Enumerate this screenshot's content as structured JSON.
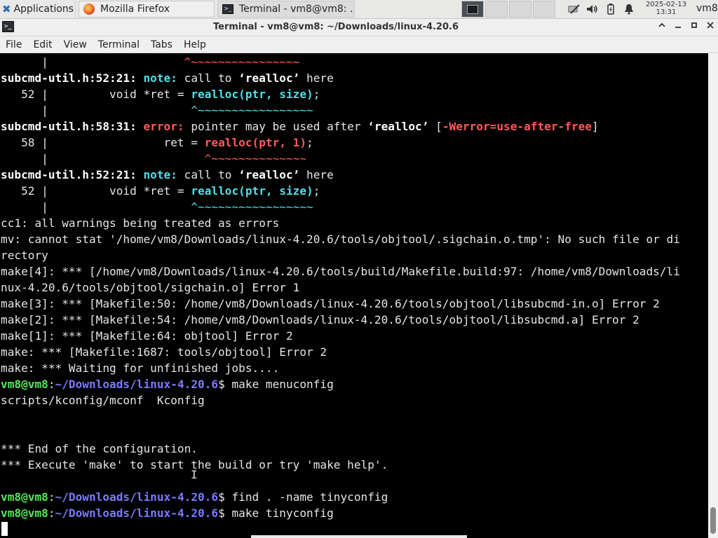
{
  "taskbar": {
    "apps_menu_label": "Applications",
    "tasks": [
      {
        "label": "Mozilla Firefox",
        "icon": "firefox-icon"
      },
      {
        "label": "Terminal - vm8@vm8: ...",
        "icon": "terminal-icon"
      }
    ],
    "workspaces": 4,
    "clock_date": "2025-02-13",
    "clock_time": "13:31",
    "user": "vm8",
    "tray_icons": [
      "network-icon",
      "volume-icon",
      "battery-icon",
      "notification-bell-icon"
    ]
  },
  "window": {
    "title": "Terminal - vm8@vm8: ~/Downloads/linux-4.20.6"
  },
  "menubar": {
    "items": [
      "File",
      "Edit",
      "View",
      "Terminal",
      "Tabs",
      "Help"
    ]
  },
  "terminal": {
    "lines": [
      [
        {
          "t": "      |                    "
        },
        {
          "t": "^~~~~~~~~~~~~~~~~",
          "c": "r"
        }
      ],
      [
        {
          "t": "subcmd-util.h:52:21: ",
          "c": "w b"
        },
        {
          "t": "note: ",
          "c": "c b"
        },
        {
          "t": "call to "
        },
        {
          "t": "‘realloc’",
          "c": "w b"
        },
        {
          "t": " here"
        }
      ],
      [
        {
          "t": "   52 |         void *ret = "
        },
        {
          "t": "realloc(ptr, size)",
          "c": "c b"
        },
        {
          "t": ";"
        }
      ],
      [
        {
          "t": "      |                     "
        },
        {
          "t": "^~~~~~~~~~~~~~~~~~",
          "c": "c"
        }
      ],
      [
        {
          "t": "subcmd-util.h:58:31: ",
          "c": "w b"
        },
        {
          "t": "error: ",
          "c": "r b"
        },
        {
          "t": "pointer may be used after "
        },
        {
          "t": "‘realloc’",
          "c": "w b"
        },
        {
          "t": " ["
        },
        {
          "t": "-Werror=use-after-free",
          "c": "r b"
        },
        {
          "t": "]"
        }
      ],
      [
        {
          "t": "   58 |                 ret = "
        },
        {
          "t": "realloc(ptr, 1)",
          "c": "r b"
        },
        {
          "t": ";"
        }
      ],
      [
        {
          "t": "      |                       "
        },
        {
          "t": "^~~~~~~~~~~~~~~",
          "c": "r"
        }
      ],
      [
        {
          "t": "subcmd-util.h:52:21: ",
          "c": "w b"
        },
        {
          "t": "note: ",
          "c": "c b"
        },
        {
          "t": "call to "
        },
        {
          "t": "‘realloc’",
          "c": "w b"
        },
        {
          "t": " here"
        }
      ],
      [
        {
          "t": "   52 |         void *ret = "
        },
        {
          "t": "realloc(ptr, size)",
          "c": "c b"
        },
        {
          "t": ";"
        }
      ],
      [
        {
          "t": "      |                     "
        },
        {
          "t": "^~~~~~~~~~~~~~~~~~",
          "c": "c"
        }
      ],
      [
        {
          "t": "cc1: all warnings being treated as errors"
        }
      ],
      [
        {
          "t": "mv: cannot stat '/home/vm8/Downloads/linux-4.20.6/tools/objtool/.sigchain.o.tmp': No such file or di"
        }
      ],
      [
        {
          "t": "rectory"
        }
      ],
      [
        {
          "t": "make[4]: *** [/home/vm8/Downloads/linux-4.20.6/tools/build/Makefile.build:97: /home/vm8/Downloads/li"
        }
      ],
      [
        {
          "t": "nux-4.20.6/tools/objtool/sigchain.o] Error 1"
        }
      ],
      [
        {
          "t": "make[3]: *** [Makefile:50: /home/vm8/Downloads/linux-4.20.6/tools/objtool/libsubcmd-in.o] Error 2"
        }
      ],
      [
        {
          "t": "make[2]: *** [Makefile:54: /home/vm8/Downloads/linux-4.20.6/tools/objtool/libsubcmd.a] Error 2"
        }
      ],
      [
        {
          "t": "make[1]: *** [Makefile:64: objtool] Error 2"
        }
      ],
      [
        {
          "t": "make: *** [Makefile:1687: tools/objtool] Error 2"
        }
      ],
      [
        {
          "t": "make: *** Waiting for unfinished jobs...."
        }
      ],
      [
        {
          "t": "vm8@vm8",
          "c": "g"
        },
        {
          "t": ":"
        },
        {
          "t": "~/Downloads/linux-4.20.6",
          "c": "bl"
        },
        {
          "t": "$ make menuconfig"
        }
      ],
      [
        {
          "t": "scripts/kconfig/mconf  Kconfig"
        }
      ],
      [
        {
          "t": ""
        }
      ],
      [
        {
          "t": ""
        }
      ],
      [
        {
          "t": "*** End of the configuration."
        }
      ],
      [
        {
          "t": "*** Execute 'make' to start the build or try 'make help'."
        }
      ],
      [
        {
          "t": ""
        }
      ],
      [
        {
          "t": "vm8@vm8",
          "c": "g"
        },
        {
          "t": ":"
        },
        {
          "t": "~/Downloads/linux-4.20.6",
          "c": "bl"
        },
        {
          "t": "$ find . -name tinyconfig"
        }
      ],
      [
        {
          "t": "vm8@vm8",
          "c": "g"
        },
        {
          "t": ":"
        },
        {
          "t": "~/Downloads/linux-4.20.6",
          "c": "bl"
        },
        {
          "t": "$ make tinyconfig"
        }
      ]
    ]
  }
}
